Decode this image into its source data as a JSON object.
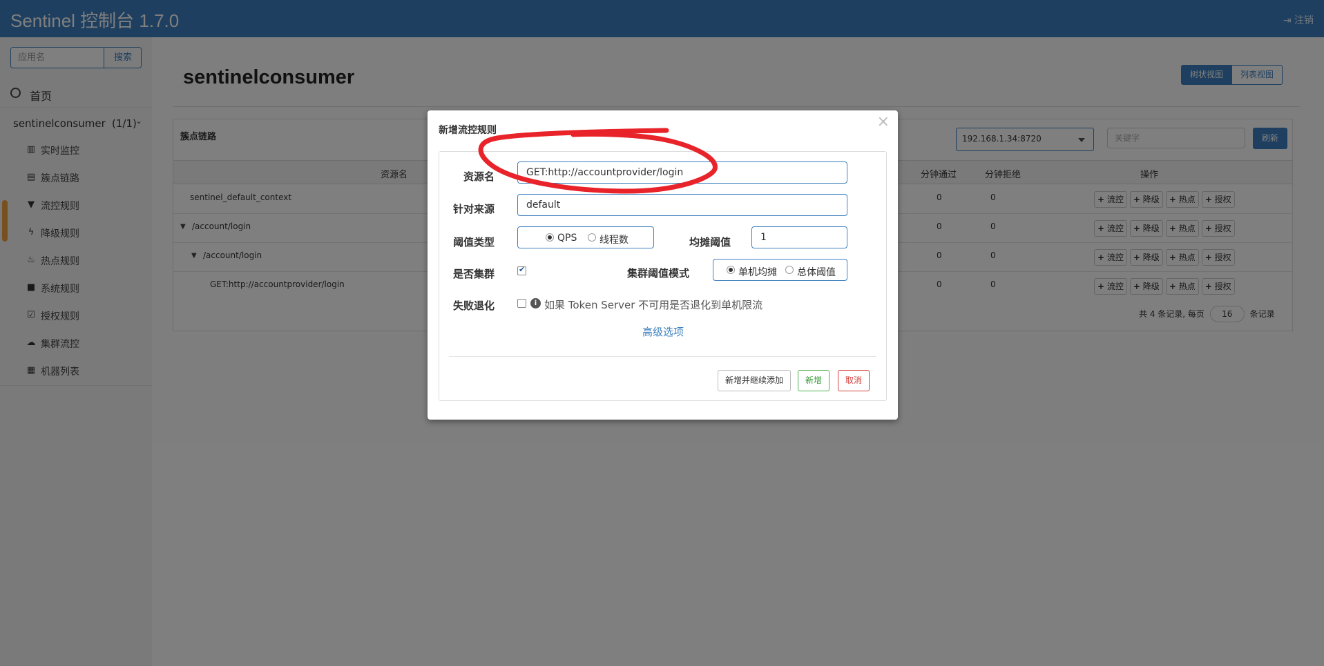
{
  "header": {
    "brand": "Sentinel 控制台 1.7.0",
    "logout": "注销"
  },
  "sidebar": {
    "search_placeholder": "应用名",
    "search_button": "搜索",
    "home": "首页",
    "app_name": "sentinelconsumer",
    "app_count": "(1/1)",
    "items": [
      {
        "label": "实时监控",
        "icon": "bar-chart-icon"
      },
      {
        "label": "簇点链路",
        "icon": "list-icon"
      },
      {
        "label": "流控规则",
        "icon": "filter-icon"
      },
      {
        "label": "降级规则",
        "icon": "flash-icon"
      },
      {
        "label": "热点规则",
        "icon": "fire-icon"
      },
      {
        "label": "系统规则",
        "icon": "lock-icon"
      },
      {
        "label": "授权规则",
        "icon": "check-icon"
      },
      {
        "label": "集群流控",
        "icon": "cloud-icon"
      },
      {
        "label": "机器列表",
        "icon": "grid-icon"
      }
    ]
  },
  "main": {
    "title": "sentinelconsumer",
    "view_tree": "树状视图",
    "view_list": "列表视图",
    "panel_title": "簇点链路",
    "machine": "192.168.1.34:8720",
    "keyword_placeholder": "关键字",
    "refresh": "刷新",
    "columns": {
      "resource": "资源名",
      "pass": "分钟通过",
      "block": "分钟拒绝",
      "ops": "操作"
    },
    "rows": [
      {
        "name": "sentinel_default_context",
        "pass": "0",
        "block": "0"
      },
      {
        "name": "/account/login",
        "pass": "0",
        "block": "0"
      },
      {
        "name": "/account/login",
        "pass": "0",
        "block": "0"
      },
      {
        "name": "GET:http://accountprovider/login",
        "pass": "0",
        "block": "0"
      }
    ],
    "op_labels": [
      "流控",
      "降级",
      "热点",
      "授权"
    ],
    "pager_prefix": "共 4 条记录, 每页",
    "page_size": "16",
    "pager_suffix": "条记录"
  },
  "modal": {
    "title": "新增流控规则",
    "close": "×",
    "resource_label": "资源名",
    "resource_value": "GET:http://accountprovider/login",
    "origin_label": "针对来源",
    "origin_value": "default",
    "threshold_type_label": "阈值类型",
    "qps": "QPS",
    "threads": "线程数",
    "avg_threshold_label": "均摊阈值",
    "avg_threshold_value": "1",
    "cluster_label": "是否集群",
    "cluster_mode_label": "集群阈值模式",
    "mode_single": "单机均摊",
    "mode_total": "总体阈值",
    "fallback_label": "失败退化",
    "fallback_hint": "如果 Token Server 不可用是否退化到单机限流",
    "advanced": "高级选项",
    "btn_add_continue": "新增并继续添加",
    "btn_add": "新增",
    "btn_cancel": "取消"
  },
  "colors": {
    "primary": "#3c7fbe",
    "annotation": "#e8232a"
  }
}
